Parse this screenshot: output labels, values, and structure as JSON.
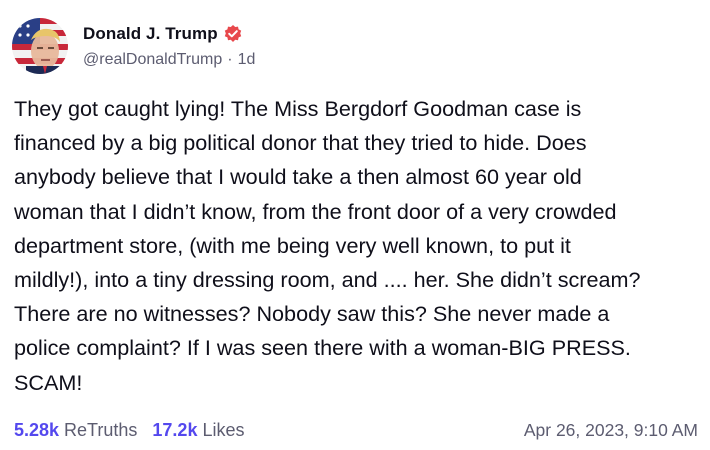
{
  "author": {
    "display_name": "Donald J. Trump",
    "handle": "@realDonaldTrump",
    "separator": "·",
    "age": "1d",
    "verified_color": "#e8484c",
    "avatar_icon": "avatar-flag-portrait"
  },
  "post": {
    "text": "They got caught lying! The Miss Bergdorf Goodman case is\nfinanced by a big political donor that they tried to hide. Does\nanybody believe that I would take a then almost 60 year old\nwoman that I didn’t know, from the front door of a very crowded\ndepartment store, (with me being very well known, to put it\nmildly!), into a tiny dressing room, and .... her. She didn’t scream?\nThere are no witnesses? Nobody saw this? She never made a\npolice complaint? If I was seen there with a woman-BIG PRESS.\nSCAM!"
  },
  "stats": {
    "retruths_count": "5.28k",
    "retruths_label": "ReTruths",
    "likes_count": "17.2k",
    "likes_label": "Likes",
    "accent_color": "#5448ee"
  },
  "timestamp": "Apr 26, 2023, 9:10 AM"
}
